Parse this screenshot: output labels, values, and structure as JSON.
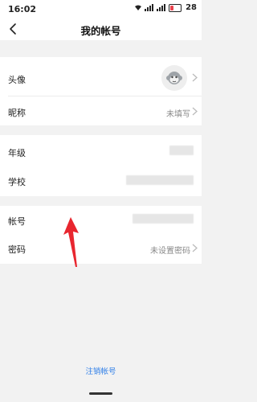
{
  "status_bar": {
    "time": "16:02",
    "battery": "28"
  },
  "header": {
    "title": "我的帐号"
  },
  "rows": {
    "avatar": {
      "label": "头像"
    },
    "nickname": {
      "label": "昵称",
      "value": "未填写"
    },
    "grade": {
      "label": "年级"
    },
    "school": {
      "label": "学校"
    },
    "account": {
      "label": "帐号"
    },
    "password": {
      "label": "密码",
      "value": "未设置密码"
    }
  },
  "footer": {
    "cancel_account": "注销帐号"
  },
  "colors": {
    "accent": "#2f7fe8",
    "annotation_arrow": "#e8262f"
  }
}
